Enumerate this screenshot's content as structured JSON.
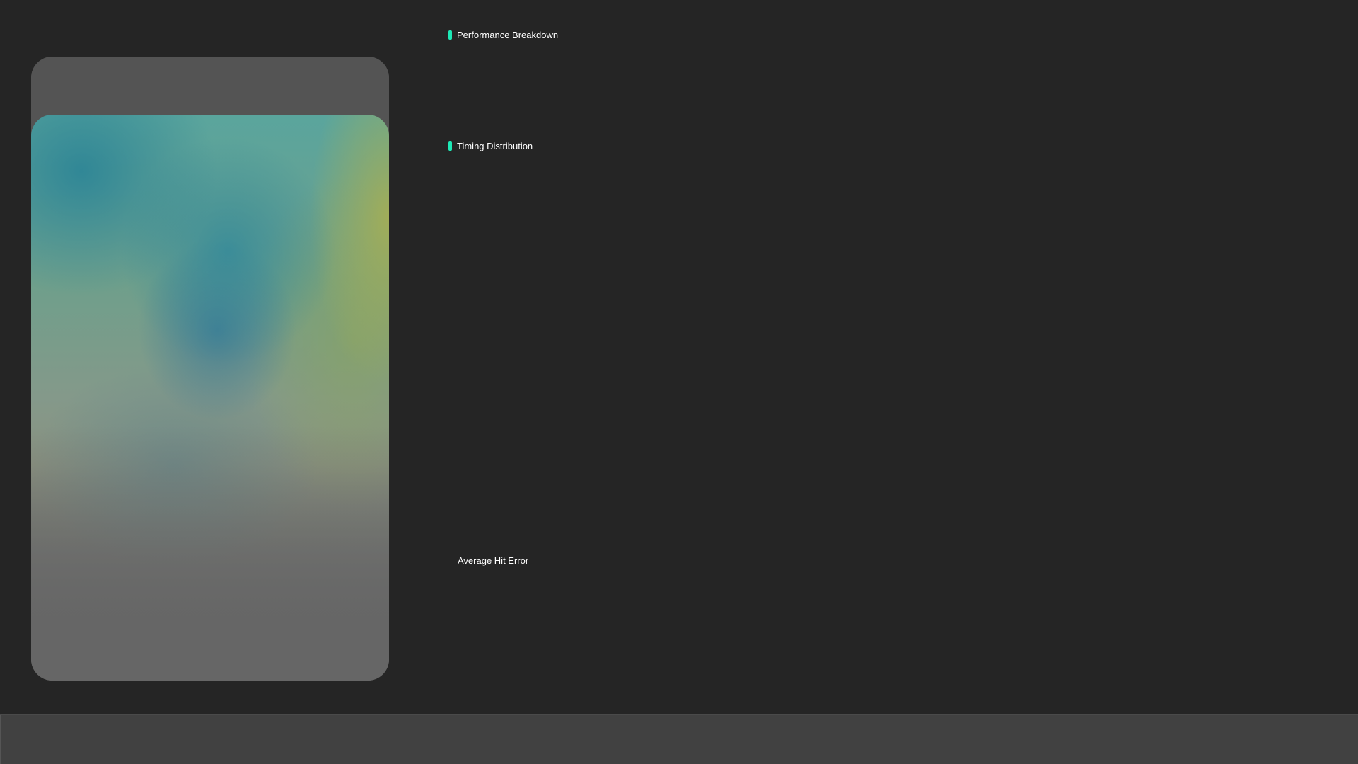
{
  "theme": {
    "background": "#252525",
    "accent": "#1de9b6",
    "card": "#545454",
    "bottom_bar": "#414141"
  },
  "sections": {
    "performance_breakdown": "Performance Breakdown",
    "timing_distribution": "Timing Distribution"
  },
  "stats": {
    "average_hit_error_label": "Average Hit Error"
  }
}
